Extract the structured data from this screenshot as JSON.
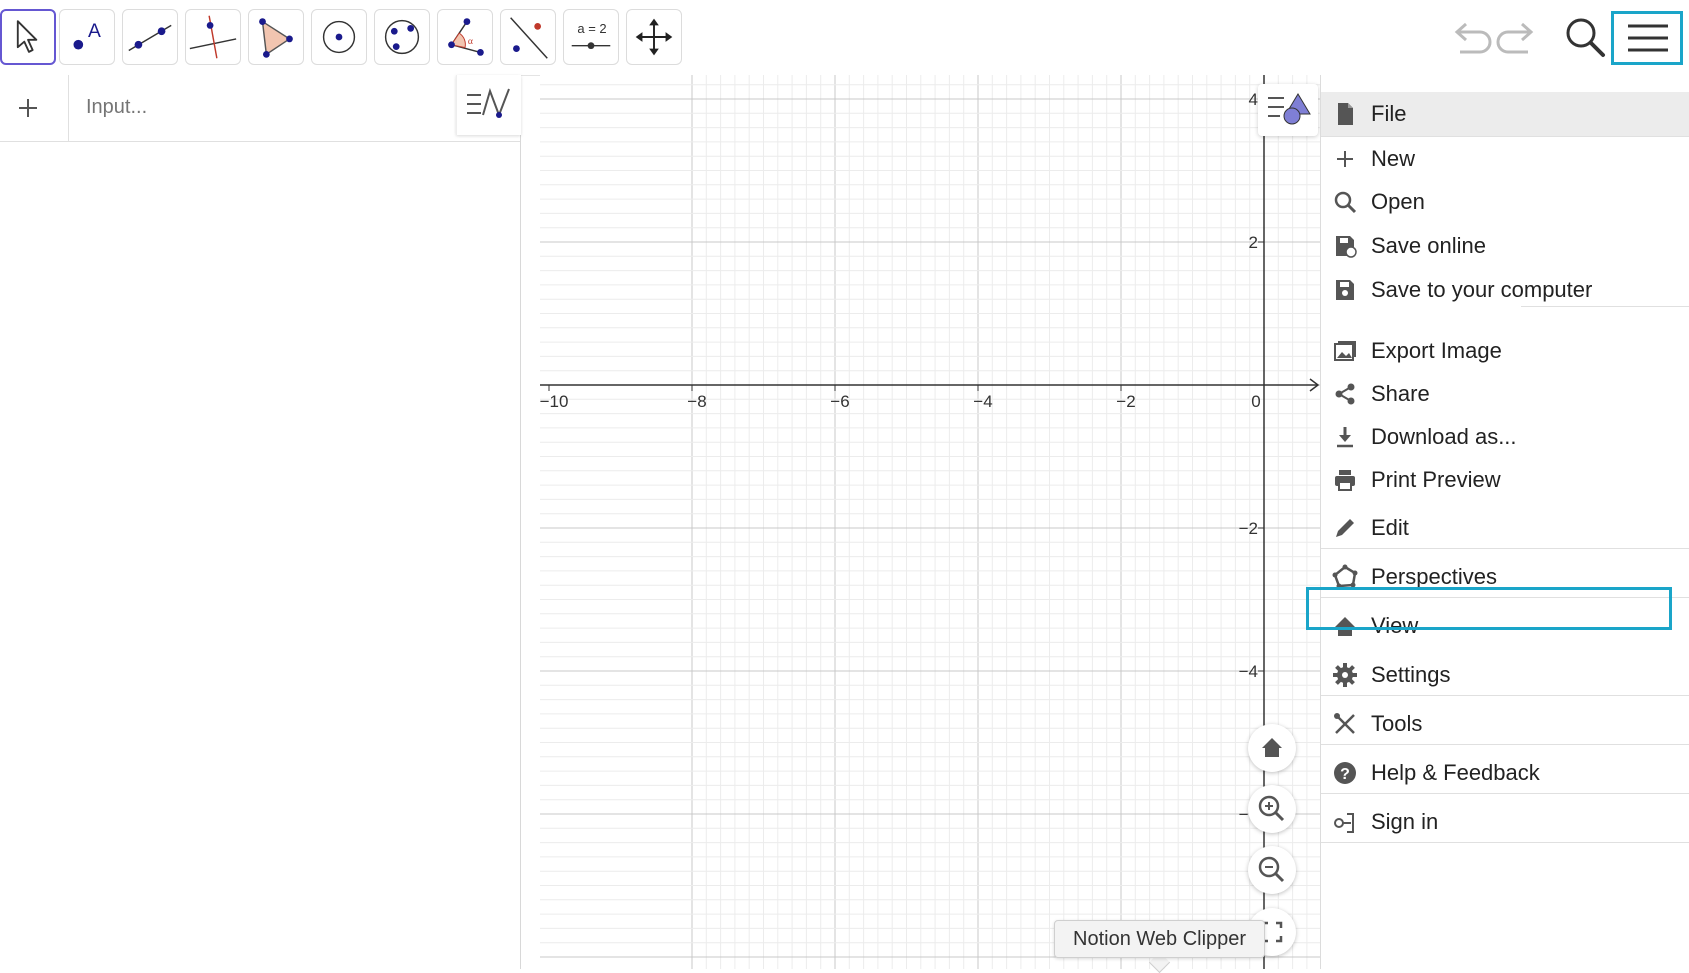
{
  "toolbar": {
    "tools": [
      {
        "name": "move-tool",
        "icon": "cursor-arrow-icon",
        "selected": true
      },
      {
        "name": "point-tool",
        "icon": "point-icon",
        "selected": false
      },
      {
        "name": "line-tool",
        "icon": "line-through-points-icon",
        "selected": false
      },
      {
        "name": "perpendicular-line-tool",
        "icon": "perpendicular-line-icon",
        "selected": false
      },
      {
        "name": "polygon-tool",
        "icon": "polygon-icon",
        "selected": false
      },
      {
        "name": "circle-center-point-tool",
        "icon": "circle-center-icon",
        "selected": false
      },
      {
        "name": "circle-three-points-tool",
        "icon": "circle-three-points-icon",
        "selected": false
      },
      {
        "name": "angle-tool",
        "icon": "angle-icon",
        "selected": false
      },
      {
        "name": "reflect-tool",
        "icon": "reflect-about-line-icon",
        "selected": false
      },
      {
        "name": "slider-tool",
        "icon": "slider-icon",
        "selected": false,
        "label": "a = 2"
      },
      {
        "name": "move-graphics-view-tool",
        "icon": "move-graphics-icon",
        "selected": false
      }
    ],
    "undo_icon": "undo-icon",
    "redo_icon": "redo-icon",
    "search_icon": "search-icon",
    "menu_icon": "hamburger-menu-icon"
  },
  "algebra": {
    "input_placeholder": "Input..."
  },
  "graphics": {
    "x_ticks": [
      "−10",
      "−8",
      "−6",
      "−4",
      "−2",
      "0"
    ],
    "y_ticks": [
      "4",
      "2",
      "−2",
      "−4",
      "−6"
    ]
  },
  "main_menu": {
    "items": [
      {
        "label": "File",
        "icon": "file-icon"
      },
      {
        "label": "New",
        "icon": "plus-icon"
      },
      {
        "label": "Open",
        "icon": "search-icon"
      },
      {
        "label": "Save online",
        "icon": "save-online-icon"
      },
      {
        "label": "Save to your computer",
        "icon": "save-icon"
      },
      {
        "label": "Export Image",
        "icon": "image-icon"
      },
      {
        "label": "Share",
        "icon": "share-icon"
      },
      {
        "label": "Download as...",
        "icon": "download-icon"
      },
      {
        "label": "Print Preview",
        "icon": "print-icon"
      },
      {
        "label": "Edit",
        "icon": "pencil-icon"
      },
      {
        "label": "Perspectives",
        "icon": "perspectives-icon"
      },
      {
        "label": "View",
        "icon": "home-icon"
      },
      {
        "label": "Settings",
        "icon": "gear-icon"
      },
      {
        "label": "Tools",
        "icon": "tools-icon"
      },
      {
        "label": "Help & Feedback",
        "icon": "help-icon"
      },
      {
        "label": "Sign in",
        "icon": "sign-in-icon"
      }
    ]
  },
  "tooltip": {
    "text": "Notion Web Clipper"
  },
  "colors": {
    "highlight": "#1aa5c9",
    "selected_tool": "#6557d2",
    "point": "#1a1a8c"
  }
}
